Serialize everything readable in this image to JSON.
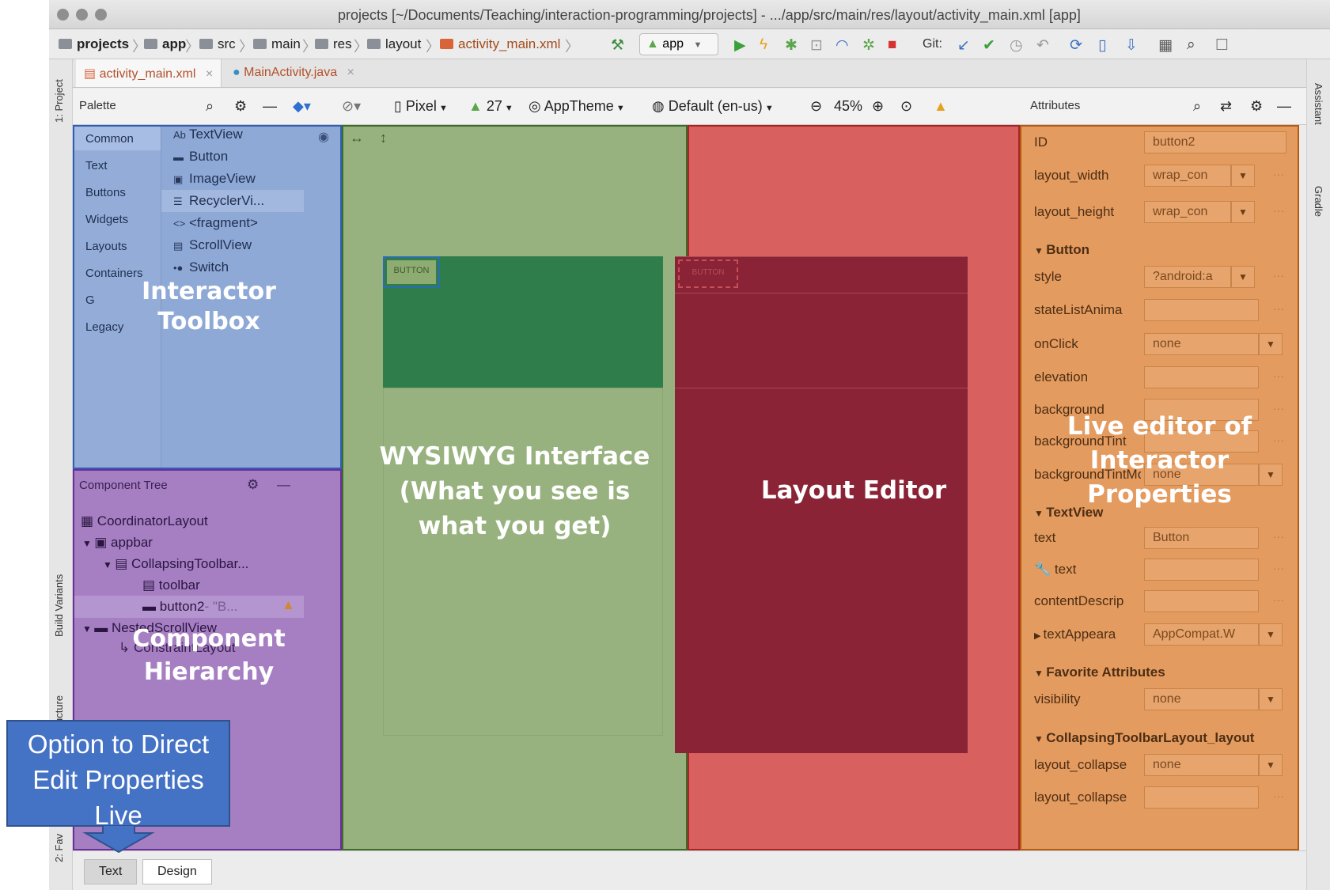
{
  "window": {
    "title": "projects [~/Documents/Teaching/interaction-programming/projects] - .../app/src/main/res/layout/activity_main.xml [app]"
  },
  "breadcrumbs": [
    "projects",
    "app",
    "src",
    "main",
    "res",
    "layout",
    "activity_main.xml"
  ],
  "run_config": "app",
  "git_label": "Git:",
  "file_tabs": [
    {
      "label": "activity_main.xml",
      "active": true
    },
    {
      "label": "MainActivity.java",
      "active": false
    }
  ],
  "editor_toolbar": {
    "palette_title": "Palette",
    "device": "Pixel",
    "api": "27",
    "theme": "AppTheme",
    "locale": "Default (en-us)",
    "zoom": "45%",
    "attributes_title": "Attributes"
  },
  "side_tool_windows": {
    "project": "1: Project",
    "build_variants": "Build Variants",
    "structure": "ucture",
    "favorites": "2: Fav",
    "assistant": "Assistant",
    "gradle": "Gradle"
  },
  "palette": {
    "categories": [
      "Common",
      "Text",
      "Buttons",
      "Widgets",
      "Layouts",
      "Containers",
      "G",
      "Legacy"
    ],
    "items": [
      {
        "icon": "Ab",
        "label": "TextView"
      },
      {
        "icon": "▬",
        "label": "Button"
      },
      {
        "icon": "▣",
        "label": "ImageView"
      },
      {
        "icon": "☰",
        "label": "RecyclerVi..."
      },
      {
        "icon": "<>",
        "label": "<fragment>"
      },
      {
        "icon": "▤",
        "label": "ScrollView"
      },
      {
        "icon": "•●",
        "label": "Switch"
      }
    ]
  },
  "component_tree": {
    "title": "Component Tree",
    "items": [
      {
        "label": "CoordinatorLayout"
      },
      {
        "label": "appbar"
      },
      {
        "label": "CollapsingToolbar..."
      },
      {
        "label": "toolbar"
      },
      {
        "label": "button2",
        "suffix": "- \"B...",
        "selected": true
      },
      {
        "label": "NestedScrollView"
      },
      {
        "label": "ConstraintLayout"
      }
    ]
  },
  "canvas": {
    "design_button_text": "BUTTON",
    "blueprint_button_text": "BUTTON"
  },
  "attributes": {
    "rows": [
      {
        "label": "ID",
        "value": "button2"
      },
      {
        "label": "layout_width",
        "value": "wrap_con"
      },
      {
        "label": "layout_height",
        "value": "wrap_con"
      },
      {
        "section": "Button"
      },
      {
        "label": "style",
        "value": "?android:a"
      },
      {
        "label": "stateListAnima",
        "value": ""
      },
      {
        "label": "onClick",
        "value": "none"
      },
      {
        "label": "elevation",
        "value": ""
      },
      {
        "label": "background",
        "value": ""
      },
      {
        "label": "backgroundTint",
        "value": ""
      },
      {
        "label": "backgroundTintMode",
        "value": "none"
      },
      {
        "section": "TextView"
      },
      {
        "label": "text",
        "value": "Button"
      },
      {
        "label": "text",
        "value": ""
      },
      {
        "label": "contentDescrip",
        "value": ""
      },
      {
        "label": "textAppeara",
        "value": "AppCompat.W"
      },
      {
        "section": "Favorite Attributes"
      },
      {
        "label": "visibility",
        "value": "none"
      },
      {
        "section": "CollapsingToolbarLayout_layout"
      },
      {
        "label": "layout_collapse",
        "value": "none"
      },
      {
        "label": "layout_collapse",
        "value": ""
      }
    ]
  },
  "bottom_tabs": [
    "Text",
    "Design"
  ],
  "overlays": {
    "toolbox": "Interactor Toolbox",
    "hierarchy_line1": "Component",
    "hierarchy_line2": "Hierarchy",
    "wysiwyg_line1": "WYSIWYG Interface",
    "wysiwyg_line2": "(What you see is",
    "wysiwyg_line3": "what you get)",
    "layout_editor": "Layout Editor",
    "live_line1": "Live editor of",
    "live_line2": "Interactor",
    "live_line3": "Properties",
    "callout_line1": "Option to Direct",
    "callout_line2": "Edit Properties",
    "callout_line3": "Live"
  },
  "colors": {
    "toolbox_region": "#8fa9d7",
    "hierarchy_region": "#a67fc3",
    "wysiwyg_region": "#97b27e",
    "layout_region": "#d8605e",
    "attributes_region": "#e49b5f",
    "callout": "#4472c4"
  }
}
